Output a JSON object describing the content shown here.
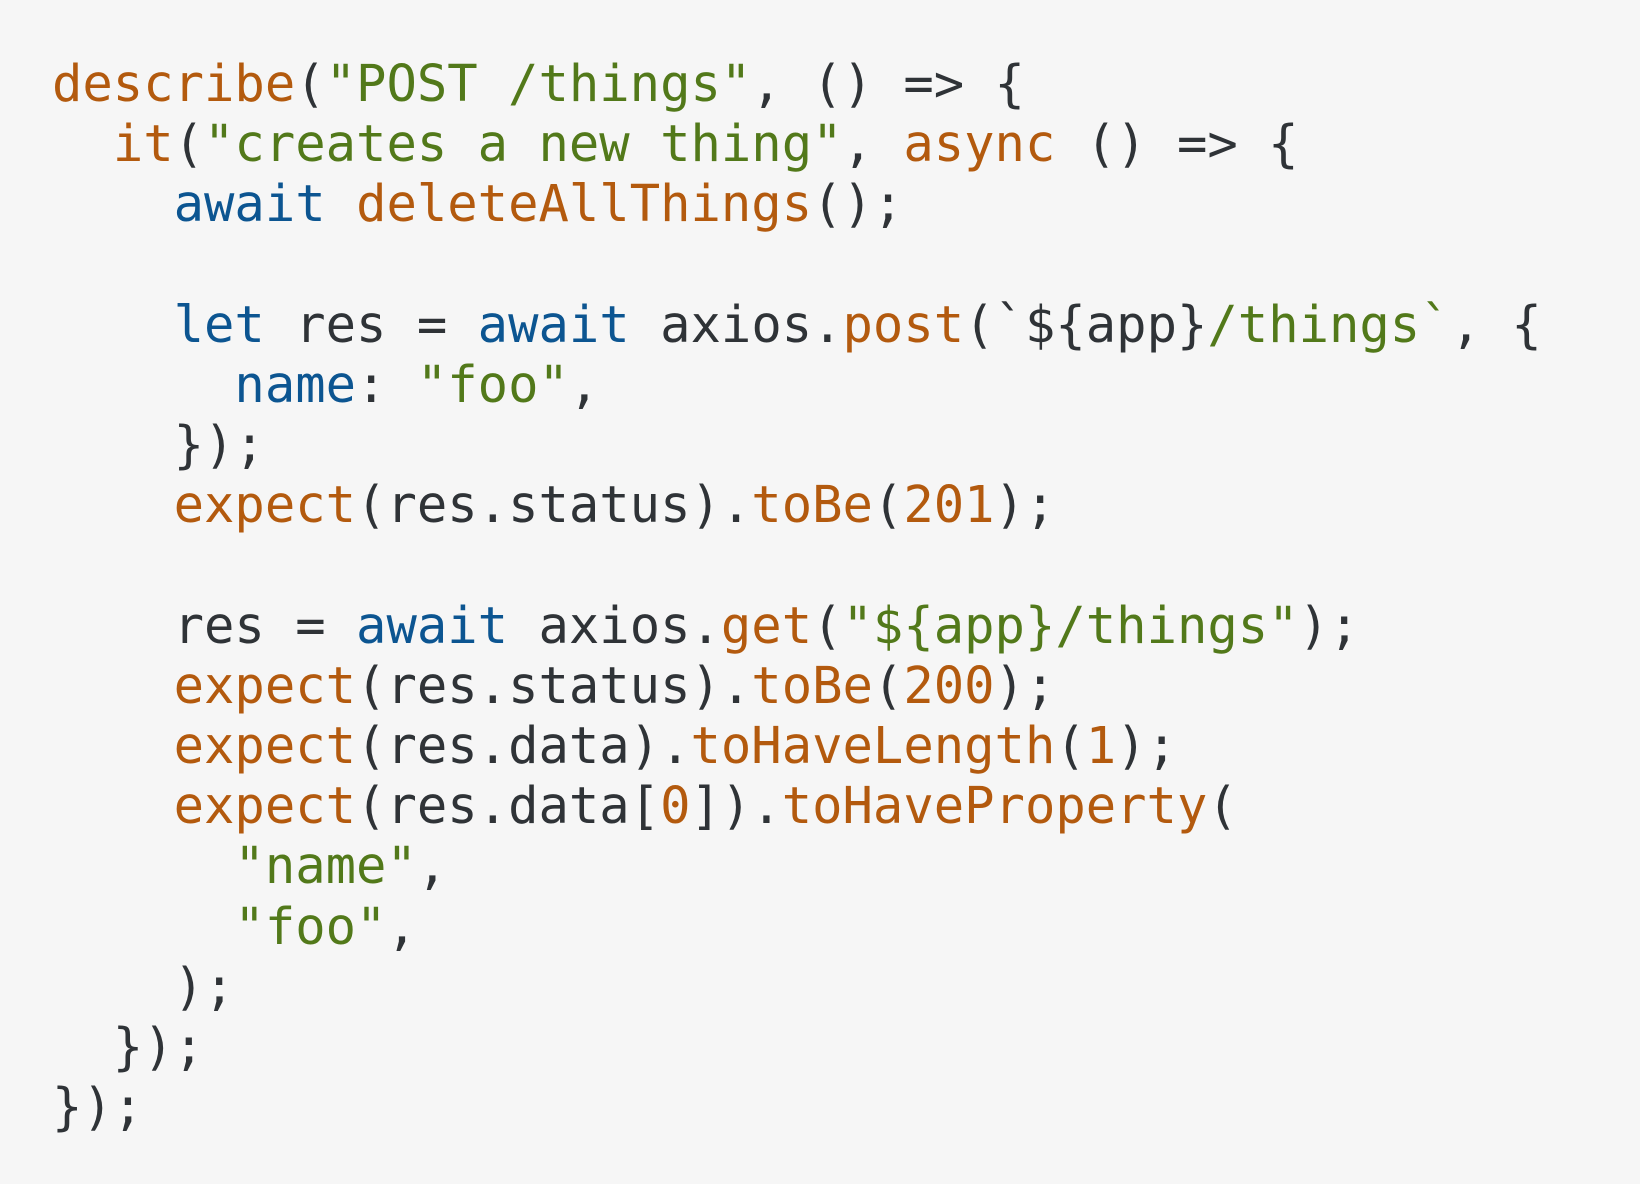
{
  "colors": {
    "background": "#f6f6f6",
    "plain": "#2f3337",
    "function": "#b35a0e",
    "keyword": "#0c5591",
    "string": "#52791a",
    "number": "#b35a0e"
  },
  "code": {
    "language": "javascript",
    "lines": [
      [
        [
          "fn",
          "describe"
        ],
        [
          "plain",
          "("
        ],
        [
          "str",
          "\"POST /things\""
        ],
        [
          "plain",
          ", () => {"
        ]
      ],
      [
        [
          "plain",
          "  "
        ],
        [
          "fn",
          "it"
        ],
        [
          "plain",
          "("
        ],
        [
          "str",
          "\"creates a new thing\""
        ],
        [
          "plain",
          ", "
        ],
        [
          "fn",
          "async"
        ],
        [
          "plain",
          " () => {"
        ]
      ],
      [
        [
          "plain",
          "    "
        ],
        [
          "kw",
          "await"
        ],
        [
          "plain",
          " "
        ],
        [
          "fn",
          "deleteAllThings"
        ],
        [
          "plain",
          "();"
        ]
      ],
      [],
      [
        [
          "plain",
          "    "
        ],
        [
          "kw",
          "let"
        ],
        [
          "plain",
          " res = "
        ],
        [
          "kw",
          "await"
        ],
        [
          "plain",
          " axios."
        ],
        [
          "fn",
          "post"
        ],
        [
          "plain",
          "(`${app}"
        ],
        [
          "str",
          "/things`"
        ],
        [
          "plain",
          ", {"
        ]
      ],
      [
        [
          "plain",
          "      "
        ],
        [
          "kw",
          "name"
        ],
        [
          "plain",
          ": "
        ],
        [
          "str",
          "\"foo\""
        ],
        [
          "plain",
          ","
        ]
      ],
      [
        [
          "plain",
          "    });"
        ]
      ],
      [
        [
          "plain",
          "    "
        ],
        [
          "fn",
          "expect"
        ],
        [
          "plain",
          "(res.status)."
        ],
        [
          "fn",
          "toBe"
        ],
        [
          "plain",
          "("
        ],
        [
          "num",
          "201"
        ],
        [
          "plain",
          ");"
        ]
      ],
      [],
      [
        [
          "plain",
          "    res = "
        ],
        [
          "kw",
          "await"
        ],
        [
          "plain",
          " axios."
        ],
        [
          "fn",
          "get"
        ],
        [
          "plain",
          "("
        ],
        [
          "str",
          "\"${app}/things\""
        ],
        [
          "plain",
          ");"
        ]
      ],
      [
        [
          "plain",
          "    "
        ],
        [
          "fn",
          "expect"
        ],
        [
          "plain",
          "(res.status)."
        ],
        [
          "fn",
          "toBe"
        ],
        [
          "plain",
          "("
        ],
        [
          "num",
          "200"
        ],
        [
          "plain",
          ");"
        ]
      ],
      [
        [
          "plain",
          "    "
        ],
        [
          "fn",
          "expect"
        ],
        [
          "plain",
          "(res.data)."
        ],
        [
          "fn",
          "toHaveLength"
        ],
        [
          "plain",
          "("
        ],
        [
          "num",
          "1"
        ],
        [
          "plain",
          ");"
        ]
      ],
      [
        [
          "plain",
          "    "
        ],
        [
          "fn",
          "expect"
        ],
        [
          "plain",
          "(res.data["
        ],
        [
          "num",
          "0"
        ],
        [
          "plain",
          "])."
        ],
        [
          "fn",
          "toHaveProperty"
        ],
        [
          "plain",
          "("
        ]
      ],
      [
        [
          "plain",
          "      "
        ],
        [
          "str",
          "\"name\""
        ],
        [
          "plain",
          ","
        ]
      ],
      [
        [
          "plain",
          "      "
        ],
        [
          "str",
          "\"foo\""
        ],
        [
          "plain",
          ","
        ]
      ],
      [
        [
          "plain",
          "    );"
        ]
      ],
      [
        [
          "plain",
          "  });"
        ]
      ],
      [
        [
          "plain",
          "});"
        ]
      ]
    ]
  }
}
